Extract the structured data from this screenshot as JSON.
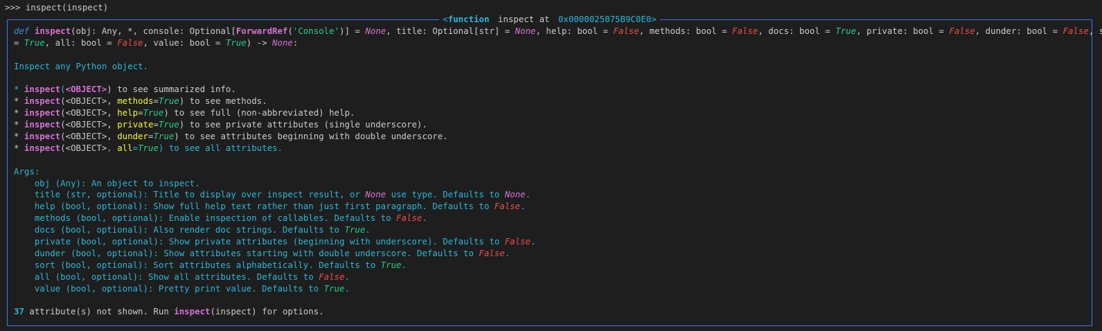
{
  "prompt": {
    "command": ">>> inspect(inspect)"
  },
  "panel": {
    "title_prefix": "<",
    "title_keyword": "function",
    "title_middle": " inspect at ",
    "title_address": "0x0000025075B9C0E0",
    "title_suffix": ">"
  },
  "signature": {
    "def": "def",
    "name": "inspect",
    "p1": "(obj: Any, *, console: Optional[",
    "fwd": "ForwardRef",
    "p2": "(",
    "console_str": "'Console'",
    "p3": ")] = ",
    "none1": "None",
    "p4": ", title: Optional[str] = ",
    "none2": "None",
    "p5": ", help: bool = ",
    "false1": "False",
    "p6": ", methods: bool = ",
    "false2": "False",
    "p7": ", docs: bool = ",
    "true1": "True",
    "p8": ", private: bool = ",
    "false3": "False",
    "p9": ", dunder: bool = ",
    "false4": "False",
    "p10": ", sort: bool",
    "p11": "= ",
    "true2": "True",
    "p12": ", all: bool = ",
    "false5": "False",
    "p13": ", value: bool = ",
    "true3": "True",
    "p14": ") -> ",
    "none3": "None",
    "p15": ":"
  },
  "summary": "Inspect any Python object.",
  "usage": [
    {
      "bullet": "* ",
      "fn": "inspect",
      "open": "(",
      "obj": "<OBJECT>",
      "close": ")",
      "rest": " to see summarized info."
    },
    {
      "bullet": "* ",
      "fn": "inspect",
      "open": "(",
      "obj": "<OBJECT>",
      "sep": ", ",
      "param": "methods",
      "eq": "=",
      "val": "True",
      "close": ")",
      "rest": " to see methods."
    },
    {
      "bullet": "* ",
      "fn": "inspect",
      "open": "(",
      "obj": "<OBJECT>",
      "sep": ", ",
      "param": "help",
      "eq": "=",
      "val": "True",
      "close": ")",
      "rest": " to see full (non-abbreviated) help."
    },
    {
      "bullet": "* ",
      "fn": "inspect",
      "open": "(",
      "obj": "<OBJECT>",
      "sep": ", ",
      "param": "private",
      "eq": "=",
      "val": "True",
      "close": ")",
      "rest": " to see private attributes (single underscore)."
    },
    {
      "bullet": "* ",
      "fn": "inspect",
      "open": "(",
      "obj": "<OBJECT>",
      "sep": ", ",
      "param": "dunder",
      "eq": "=",
      "val": "True",
      "close": ")",
      "rest": " to see attributes beginning with double underscore."
    },
    {
      "bullet": "* ",
      "fn": "inspect",
      "open": "(",
      "obj": "<OBJECT>",
      "sep": ", ",
      "param": "all",
      "eq": "=",
      "val": "True",
      "close": ")",
      "rest": " to see all attributes."
    }
  ],
  "args_header": "Args:",
  "args": [
    {
      "name": "    obj ",
      "type": "(Any)",
      "desc": ": An object to inspect.",
      "val": "",
      "end": ""
    },
    {
      "name": "    title ",
      "type": "(str, optional)",
      "desc": ": Title to display over inspect result, or ",
      "none": "None",
      "desc2": " use type. Defaults to ",
      "val": "None",
      "end": "."
    },
    {
      "name": "    help ",
      "type": "(bool, optional)",
      "desc": ": Show full help text rather than just first paragraph. Defaults to ",
      "val": "False",
      "end": "."
    },
    {
      "name": "    methods ",
      "type": "(bool, optional)",
      "desc": ": Enable inspection of callables. Defaults to ",
      "val": "False",
      "end": "."
    },
    {
      "name": "    docs ",
      "type": "(bool, optional)",
      "desc": ": Also render doc strings. Defaults to ",
      "val": "True",
      "end": "."
    },
    {
      "name": "    private ",
      "type": "(bool, optional)",
      "desc": ": Show private attributes ",
      "paren": "(beginning with underscore)",
      "desc2": ". Defaults to ",
      "val": "False",
      "end": "."
    },
    {
      "name": "    dunder ",
      "type": "(bool, optional)",
      "desc": ": Show attributes starting with double underscore. Defaults to ",
      "val": "False",
      "end": "."
    },
    {
      "name": "    sort ",
      "type": "(bool, optional)",
      "desc": ": Sort attributes alphabetically. Defaults to ",
      "val": "True",
      "end": "."
    },
    {
      "name": "    all ",
      "type": "(bool, optional)",
      "desc": ": Show all attributes. Defaults to ",
      "val": "False",
      "end": "."
    },
    {
      "name": "    value ",
      "type": "(bool, optional)",
      "desc": ": Pretty print value. Defaults to ",
      "val": "True",
      "end": "."
    }
  ],
  "footer": {
    "count": "37",
    "text1": " attribute(s) not shown. Run ",
    "fn": "inspect",
    "open": "(",
    "arg": "inspect",
    "close": ")",
    "text2": " for options."
  }
}
